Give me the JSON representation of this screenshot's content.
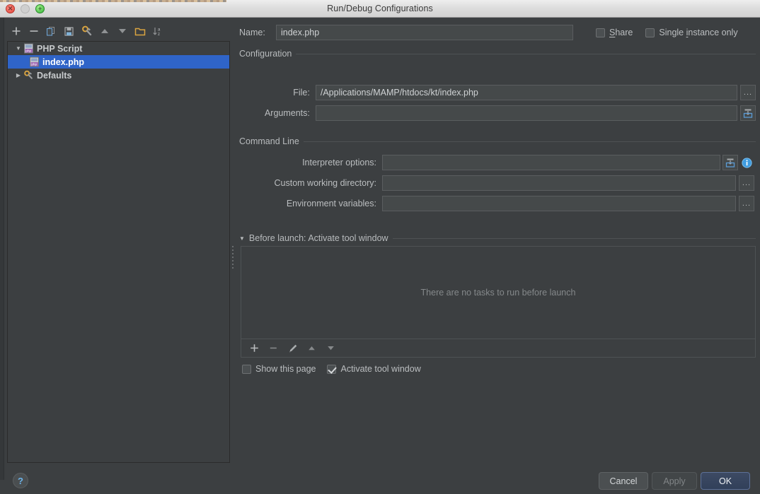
{
  "window": {
    "title": "Run/Debug Configurations",
    "traffic_lights": [
      "close-button",
      "minimize-button",
      "zoom-button"
    ]
  },
  "toolbar": {
    "buttons": [
      {
        "name": "add-configuration-button",
        "icon": "plus-icon",
        "tooltip": "Add New Configuration"
      },
      {
        "name": "remove-configuration-button",
        "icon": "minus-icon",
        "tooltip": "Remove Configuration"
      },
      {
        "name": "copy-configuration-button",
        "icon": "copy-icon",
        "tooltip": "Copy Configuration"
      },
      {
        "name": "save-configuration-button",
        "icon": "save-icon",
        "tooltip": "Save Configuration"
      },
      {
        "name": "edit-defaults-button",
        "icon": "wrench-icon",
        "tooltip": "Edit Defaults"
      },
      {
        "name": "move-up-button",
        "icon": "arrow-up-icon",
        "tooltip": "Move Up"
      },
      {
        "name": "move-down-button",
        "icon": "arrow-down-icon",
        "tooltip": "Move Down"
      },
      {
        "name": "create-folder-button",
        "icon": "folder-icon",
        "tooltip": "Create New Folder"
      },
      {
        "name": "sort-button",
        "icon": "sort-alpha-icon",
        "tooltip": "Sort Configurations"
      }
    ]
  },
  "tree": {
    "items": [
      {
        "label": "PHP Script",
        "icon": "php-file-icon",
        "expanded": true,
        "level": 0,
        "selected": false,
        "arrow": "triangle-down"
      },
      {
        "label": "index.php",
        "icon": "php-file-icon",
        "level": 1,
        "selected": true,
        "arrow": ""
      },
      {
        "label": "Defaults",
        "icon": "wrench-icon",
        "expanded": false,
        "level": 0,
        "selected": false,
        "arrow": "triangle-right"
      }
    ]
  },
  "form": {
    "name_label": "Name:",
    "name_value": "index.php",
    "share_label": "Share",
    "share_checked": false,
    "single_instance_label": "Single instance only",
    "single_instance_checked": false,
    "configuration_group": "Configuration",
    "file_label": "File:",
    "file_value": "/Applications/MAMP/htdocs/kt/index.php",
    "file_browse_label": "...",
    "arguments_label": "Arguments:",
    "arguments_value": "",
    "command_line_group": "Command Line",
    "interpreter_options_label": "Interpreter options:",
    "interpreter_options_value": "",
    "custom_working_directory_label": "Custom working directory:",
    "custom_working_directory_value": "",
    "custom_working_directory_browse": "...",
    "environment_variables_label": "Environment variables:",
    "environment_variables_value": "",
    "environment_variables_browse": "..."
  },
  "before_launch": {
    "header": "Before launch: Activate tool window",
    "expanded": true,
    "empty_text": "There are no tasks to run before launch",
    "toolbar": [
      {
        "name": "add-task-button",
        "icon": "plus-icon"
      },
      {
        "name": "remove-task-button",
        "icon": "minus-icon"
      },
      {
        "name": "edit-task-button",
        "icon": "pencil-icon"
      },
      {
        "name": "task-move-up-button",
        "icon": "arrow-up-icon"
      },
      {
        "name": "task-move-down-button",
        "icon": "arrow-down-icon"
      }
    ],
    "show_this_page_label": "Show this page",
    "show_this_page_checked": false,
    "activate_tool_window_label": "Activate tool window",
    "activate_tool_window_checked": true
  },
  "footer": {
    "cancel_label": "Cancel",
    "apply_label": "Apply",
    "apply_enabled": false,
    "ok_label": "OK",
    "help_label": "?"
  },
  "colors": {
    "background": "#3c3f41",
    "selection": "#2f64c8",
    "field_bg": "#45494a",
    "accent_blue": "#6cb3e8",
    "ok_button": "#3d4a63"
  }
}
